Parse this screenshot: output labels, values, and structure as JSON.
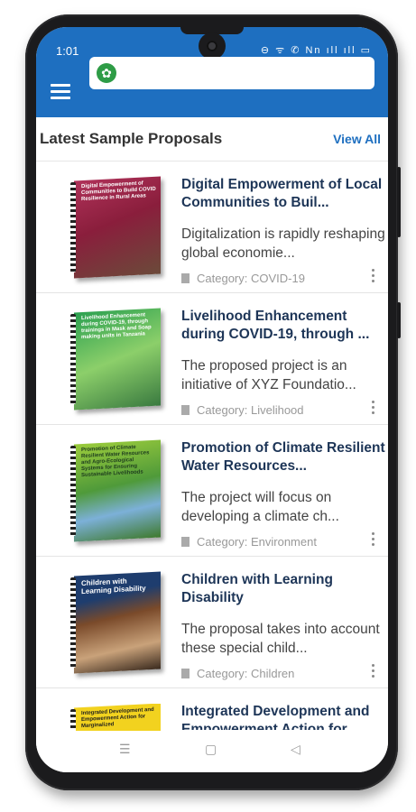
{
  "status": {
    "time": "1:01",
    "icons": "⊖ ᯤ ✆ Nn ıll ıll ▭"
  },
  "colors": {
    "accent": "#1e6fc0",
    "title": "#1d3557"
  },
  "search": {
    "placeholder": ""
  },
  "header": {
    "title": "Latest Sample Proposals",
    "view_all": "View All"
  },
  "proposals": [
    {
      "title": "Digital Empowerment of Local Communities to Buil...",
      "description": "Digitalization is rapidly reshaping global economie...",
      "category": "Category: COVID-19",
      "cover_text": "Digital Empowerment of Communities to Build COVID Resilience in Rural Areas",
      "cover_color": "#a22a4a"
    },
    {
      "title": "Livelihood Enhancement during COVID-19, through ...",
      "description": "The proposed project is an initiative of XYZ Foundatio...",
      "category": "Category: Livelihood",
      "cover_text": "Livelihood Enhancement during COVID-19, through trainings in Mask and Soap making units in Tanzania",
      "cover_color": "#2a9a4a"
    },
    {
      "title": "Promotion of Climate Resilient Water Resources...",
      "description": "The project will focus on developing a climate ch...",
      "category": "Category: Environment",
      "cover_text": "Promotion of Climate Resilient Water Resources and Agro-Ecological Systems for Ensuring Sustainable Livelihoods",
      "cover_color": "#7ab43c"
    },
    {
      "title": "Children with Learning Disability",
      "description": "The proposal takes into account these special child...",
      "category": "Category: Children",
      "cover_text": "Children with Learning Disability",
      "cover_color": "#1e3d6e"
    },
    {
      "title": "Integrated Development and Empowerment Action for...",
      "description": "",
      "category": "",
      "cover_text": "Integrated Development and Empowerment Action for Marginalized",
      "cover_color": "#f2d21f"
    }
  ],
  "navbar": {
    "recent": "☰",
    "home": "▢",
    "back": "◁"
  }
}
